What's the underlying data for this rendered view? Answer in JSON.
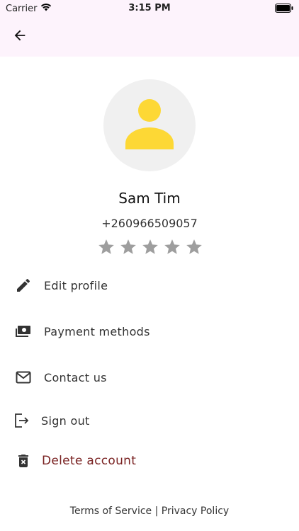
{
  "status_bar": {
    "carrier": "Carrier",
    "time": "3:15 PM"
  },
  "app_bar": {
    "back_icon": "arrow-back-icon"
  },
  "profile": {
    "avatar_icon": "person-icon",
    "avatar_color": "#fdd835",
    "name": "Sam Tim",
    "phone": "+260966509057",
    "rating": {
      "value": 0,
      "max": 5,
      "star_color": "#9e9e9e"
    }
  },
  "menu": [
    {
      "label": "Edit profile",
      "icon": "pencil-icon"
    },
    {
      "label": "Payment methods",
      "icon": "money-icon"
    },
    {
      "label": "Contact us",
      "icon": "mail-icon"
    },
    {
      "label": "Sign out",
      "icon": "logout-icon"
    },
    {
      "label": "Delete account",
      "icon": "trash-icon",
      "color": "#7a2323"
    }
  ],
  "footer": {
    "terms": "Terms of Service",
    "separator": " | ",
    "privacy": "Privacy Policy"
  }
}
